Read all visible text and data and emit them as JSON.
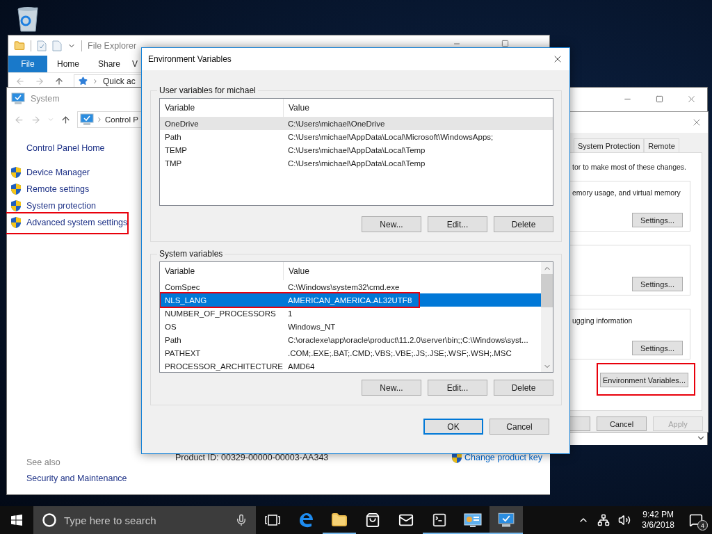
{
  "file_explorer": {
    "title": "File Explorer",
    "ribbon_tabs": [
      {
        "label": "File",
        "selected": true
      },
      {
        "label": "Home",
        "selected": false
      },
      {
        "label": "Share",
        "selected": false
      },
      {
        "label": "V",
        "selected": false
      }
    ],
    "address": "Quick ac"
  },
  "system_window": {
    "title": "System",
    "address": "Control P",
    "home_link": "Control Panel Home",
    "tasks": [
      {
        "label": "Device Manager",
        "annotated": false
      },
      {
        "label": "Remote settings",
        "annotated": false
      },
      {
        "label": "System protection",
        "annotated": false
      },
      {
        "label": "Advanced system settings",
        "annotated": true
      }
    ],
    "see_also": {
      "heading": "See also",
      "links": [
        "Security and Maintenance"
      ]
    },
    "product_id": "Product ID: 00329-00000-00003-AA343",
    "change_product_key": "Change product key"
  },
  "system_properties": {
    "tabs": [
      {
        "label": "System Protection",
        "selected": false
      },
      {
        "label": "Remote",
        "selected": false
      }
    ],
    "note": "tor to make most of these changes.",
    "groups": [
      {
        "text": "emory usage, and virtual memory",
        "button": "Settings..."
      },
      {
        "button": "Settings..."
      },
      {
        "text": "ugging information",
        "button": "Settings..."
      }
    ],
    "environment_button": {
      "label": "Environment Variables...",
      "annotated": true
    },
    "buttons": [
      {
        "label": "Cancel",
        "disabled": false
      },
      {
        "label": "Apply",
        "disabled": true
      }
    ]
  },
  "environment_variables": {
    "title": "Environment Variables",
    "groups": [
      {
        "title": "User variables for michael",
        "focused": false,
        "scrollbar": false,
        "columns": [
          "Variable",
          "Value"
        ],
        "rows": [
          {
            "variable": "OneDrive",
            "value": "C:\\Users\\michael\\OneDrive",
            "selected": true,
            "annotated": false
          },
          {
            "variable": "Path",
            "value": "C:\\Users\\michael\\AppData\\Local\\Microsoft\\WindowsApps;",
            "selected": false,
            "annotated": false
          },
          {
            "variable": "TEMP",
            "value": "C:\\Users\\michael\\AppData\\Local\\Temp",
            "selected": false,
            "annotated": false
          },
          {
            "variable": "TMP",
            "value": "C:\\Users\\michael\\AppData\\Local\\Temp",
            "selected": false,
            "annotated": false
          }
        ],
        "buttons": [
          "New...",
          "Edit...",
          "Delete"
        ]
      },
      {
        "title": "System variables",
        "focused": true,
        "scrollbar": true,
        "columns": [
          "Variable",
          "Value"
        ],
        "rows": [
          {
            "variable": "ComSpec",
            "value": "C:\\Windows\\system32\\cmd.exe",
            "selected": false,
            "annotated": false
          },
          {
            "variable": "NLS_LANG",
            "value": "AMERICAN_AMERICA.AL32UTF8",
            "selected": true,
            "annotated": true
          },
          {
            "variable": "NUMBER_OF_PROCESSORS",
            "value": "1",
            "selected": false,
            "annotated": false
          },
          {
            "variable": "OS",
            "value": "Windows_NT",
            "selected": false,
            "annotated": false
          },
          {
            "variable": "Path",
            "value": "C:\\oraclexe\\app\\oracle\\product\\11.2.0\\server\\bin;;C:\\Windows\\syst...",
            "selected": false,
            "annotated": false
          },
          {
            "variable": "PATHEXT",
            "value": ".COM;.EXE;.BAT;.CMD;.VBS;.VBE;.JS;.JSE;.WSF;.WSH;.MSC",
            "selected": false,
            "annotated": false
          },
          {
            "variable": "PROCESSOR_ARCHITECTURE",
            "value": "AMD64",
            "selected": false,
            "annotated": false
          }
        ],
        "buttons": [
          "New...",
          "Edit...",
          "Delete"
        ]
      }
    ],
    "buttons": [
      {
        "label": "OK",
        "default": true
      },
      {
        "label": "Cancel",
        "default": false
      }
    ]
  },
  "taskbar": {
    "search_placeholder": "Type here to search",
    "apps": [
      {
        "kind": "task-view",
        "open": false,
        "active": false
      },
      {
        "kind": "edge",
        "open": false,
        "active": false
      },
      {
        "kind": "file-explorer",
        "open": true,
        "active": false
      },
      {
        "kind": "store",
        "open": false,
        "active": false
      },
      {
        "kind": "mail",
        "open": false,
        "active": false
      },
      {
        "kind": "command-prompt",
        "open": true,
        "active": false
      },
      {
        "kind": "control-panel",
        "open": true,
        "active": false
      },
      {
        "kind": "system",
        "open": true,
        "active": true
      }
    ],
    "time": "9:42 PM",
    "date": "3/6/2018",
    "notification_count": "4"
  }
}
